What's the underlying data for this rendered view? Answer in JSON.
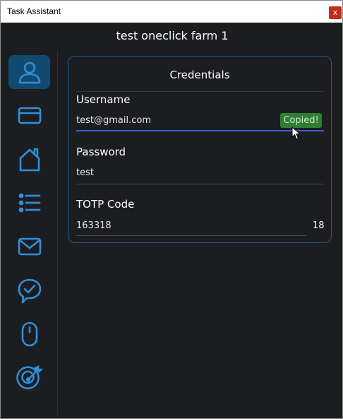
{
  "window": {
    "title": "Task Assistant",
    "close_label": "x"
  },
  "app": {
    "title": "test oneclick farm 1"
  },
  "sidebar": {
    "items": [
      {
        "icon": "user-icon",
        "active": true
      },
      {
        "icon": "credit-card-icon",
        "active": false
      },
      {
        "icon": "home-icon",
        "active": false
      },
      {
        "icon": "list-icon",
        "active": false
      },
      {
        "icon": "mail-icon",
        "active": false
      },
      {
        "icon": "chat-check-icon",
        "active": false
      },
      {
        "icon": "mouse-icon",
        "active": false
      },
      {
        "icon": "target-icon",
        "active": false
      }
    ]
  },
  "credentials": {
    "title": "Credentials",
    "username_label": "Username",
    "username_value": "test@gmail.com",
    "copied_label": "Copied!",
    "password_label": "Password",
    "password_value": "test",
    "totp_label": "TOTP Code",
    "totp_value": "163318",
    "totp_seconds": "18"
  },
  "colors": {
    "background": "#1c1d21",
    "accent": "#2f8fd8",
    "active_nav": "#134a70",
    "focus_line": "#3a5fd0",
    "copied_bg": "#2e7d32"
  }
}
